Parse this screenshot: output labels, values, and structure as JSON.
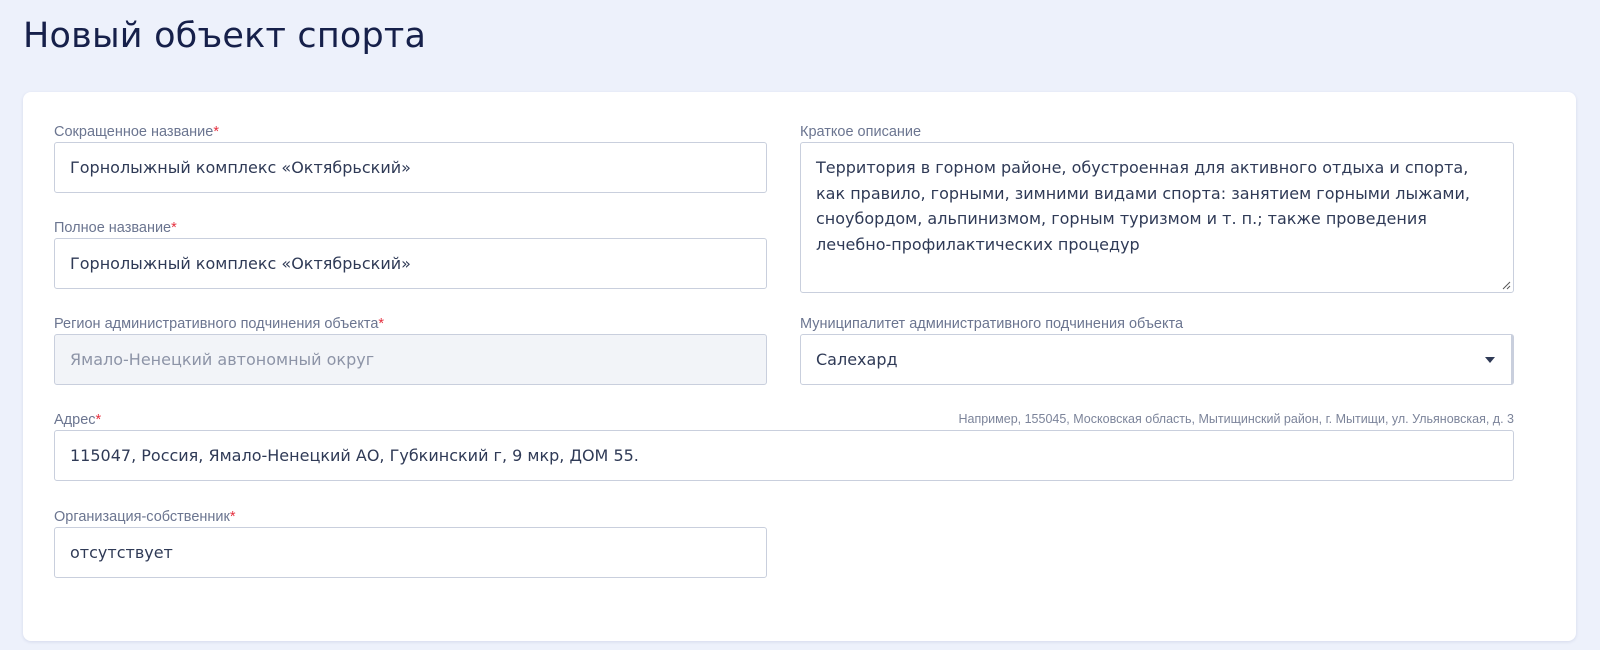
{
  "page": {
    "title": "Новый объект спорта"
  },
  "form": {
    "short_name": {
      "label": "Сокращенное название",
      "required_mark": "*",
      "value": "Горнолыжный комплекс «Октябрьский»"
    },
    "full_name": {
      "label": "Полное название",
      "required_mark": "*",
      "value": "Горнолыжный комплекс «Октябрьский»"
    },
    "region": {
      "label": "Регион административного подчинения объекта",
      "required_mark": "*",
      "value": "Ямало-Ненецкий автономный округ"
    },
    "description": {
      "label": "Краткое описание",
      "value": "Территория в горном районе, обустроенная для активного отдыха и спорта, как правило, горными, зимними видами спорта: занятием горными лыжами, сноубордом, альпинизмом, горным туризмом и т. п.; также проведения лечебно-профилактических процедур"
    },
    "municipality": {
      "label": "Муниципалитет административного подчинения объекта",
      "value": "Салехард",
      "icon": "caret-down-icon"
    },
    "address": {
      "label": "Адрес",
      "required_mark": "*",
      "hint": "Например, 155045, Московская область, Мытищинский район, г. Мытищи, ул. Ульяновская, д. 3",
      "value": "115047, Россия, Ямало-Ненецкий АО, Губкинский г, 9 мкр, ДОМ 55."
    },
    "owner": {
      "label": "Организация-собственник",
      "required_mark": "*",
      "value": "отсутствует"
    }
  },
  "colors": {
    "background": "#edf1fb",
    "title": "#16204a",
    "required": "#e5303f",
    "border": "#c9cfdd"
  }
}
